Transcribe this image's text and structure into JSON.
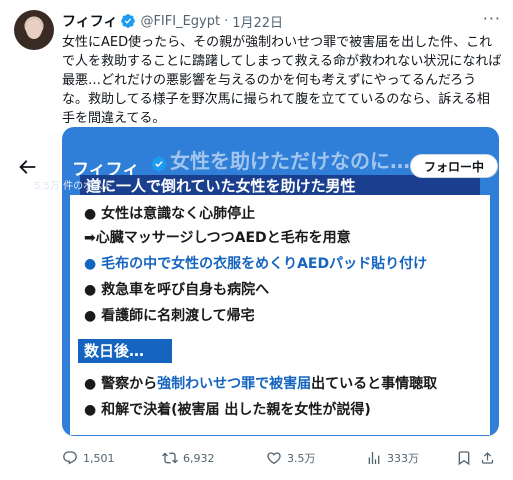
{
  "tweet": {
    "display_name": "フィフィ",
    "handle": "@FIFI_Egypt",
    "separator": "·",
    "date": "1月22日",
    "more": "···",
    "text": "女性にAED使ったら、その親が強制わいせつ罪で被害届を出した件、これで人を救助することに躊躇してしまって救える命が救われない状況になれば最悪…どれだけの悪影響を与えるのかを何も考えずにやってるんだろうな。救助してる様子を野次馬に撮られて腹を立てているのなら、訴える相手を間違えてる。"
  },
  "media": {
    "overlay_name": "フィフィ",
    "overlay_headline": "女性を助けただけなのに…",
    "post_count": "5.5万 件のポスト",
    "follow_label": "フォロー中",
    "subtitle": "道に一人で倒れていた女性を助けた男性",
    "lines": [
      "● 女性は意識なく心肺停止",
      "➡心臓マッサージしつつAEDと毛布を用意",
      "● 毛布の中で女性の衣服をめくりAEDパッド貼り付け",
      "● 救急車を呼び自身も病院へ",
      "● 看護師に名刺渡して帰宅"
    ],
    "after_label": "数日後…",
    "after_lines": [
      {
        "pre": "● 警察から",
        "em": "強制わいせつ罪で被害届",
        "post": "出ていると事情聴取"
      },
      {
        "pre": "● 和解で決着(被害届 出した親を女性が説得)",
        "em": "",
        "post": ""
      }
    ]
  },
  "actions": {
    "replies": "1,501",
    "reposts": "6,932",
    "likes": "3.5万",
    "views": "333万"
  },
  "colors": {
    "accent": "#1d9bf0",
    "media_bg": "#2f7ed8",
    "text_secondary": "#536471",
    "highlight_blue": "#1565c0"
  },
  "icons": [
    "avatar",
    "verified-icon",
    "more-icon",
    "back-arrow-icon",
    "reply-icon",
    "repost-icon",
    "like-icon",
    "views-icon",
    "bookmark-icon",
    "share-icon"
  ]
}
